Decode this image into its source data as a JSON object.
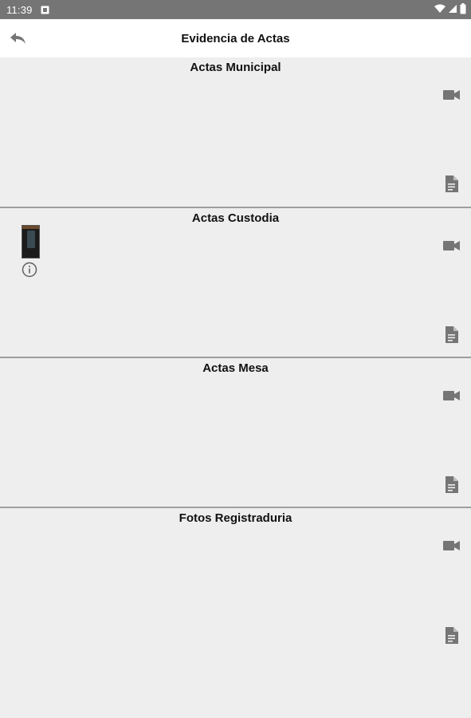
{
  "status_bar": {
    "time": "11:39"
  },
  "app_bar": {
    "title": "Evidencia de Actas"
  },
  "sections": [
    {
      "title": "Actas Municipal"
    },
    {
      "title": "Actas Custodia"
    },
    {
      "title": "Actas Mesa"
    },
    {
      "title": "Fotos Registraduria"
    }
  ],
  "icons": {
    "back": "back-arrow-icon",
    "video": "video-camera-icon",
    "document": "document-icon",
    "info": "info-icon"
  },
  "colors": {
    "icon_gray": "#757575",
    "status_bar": "#757575",
    "background": "#eeeeee",
    "divider": "#9e9e9e"
  }
}
